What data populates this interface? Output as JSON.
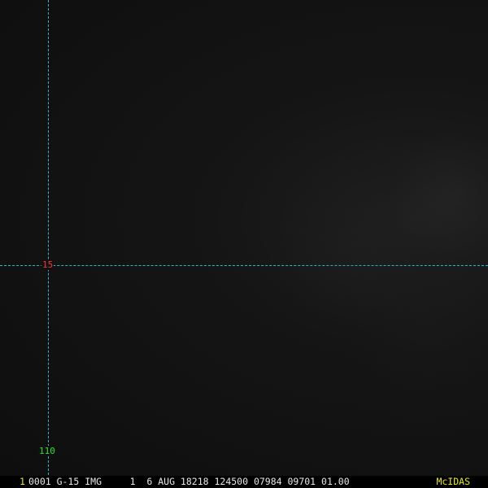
{
  "overlay": {
    "lat_label": "15",
    "lon_label": "110"
  },
  "status": {
    "frame_number": "1",
    "info": "0001 G-15 IMG     1  6 AUG 18218 124500 07984 09701 01.00",
    "brand": "McIDAS"
  },
  "colors": {
    "grid": "#2fb7c9",
    "lat_label": "#ff3333",
    "lon_label": "#33dd33",
    "frame_number": "#e8e800",
    "brand": "#e8e800",
    "status_text": "#e6e6e6"
  }
}
